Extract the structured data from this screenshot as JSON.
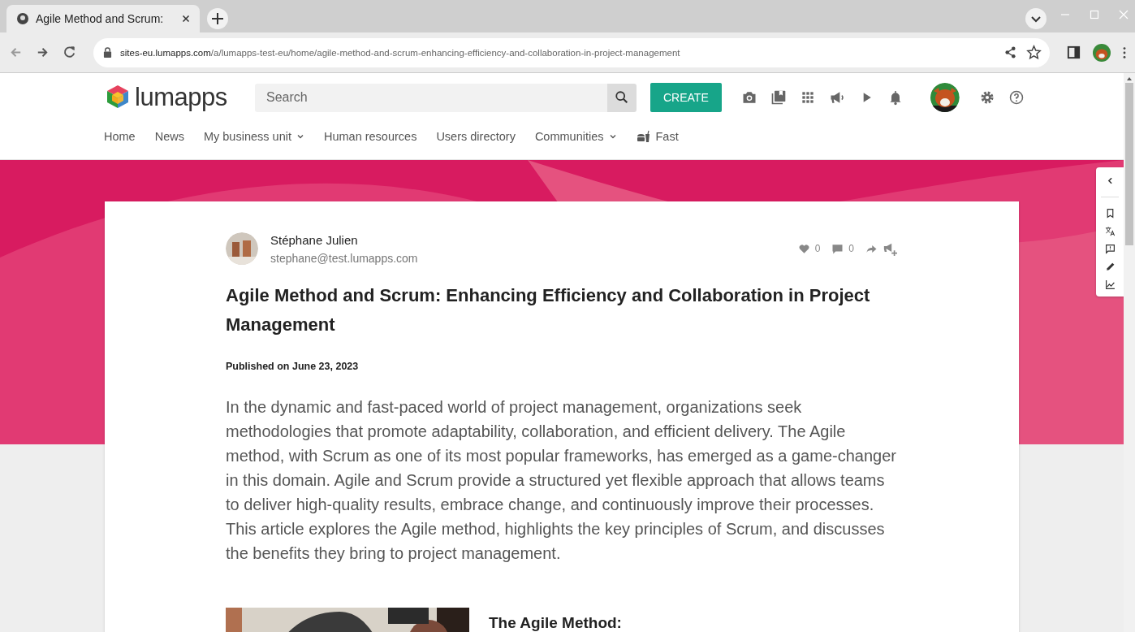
{
  "browser": {
    "tab_title": "Agile Method and Scrum:",
    "url_host": "sites-eu.lumapps.com",
    "url_path": "/a/lumapps-test-eu/home/agile-method-and-scrum-enhancing-efficiency-and-collaboration-in-project-management"
  },
  "header": {
    "logo": "lumapps",
    "search": {
      "placeholder": "Search"
    },
    "create_button": "CREATE"
  },
  "nav": [
    {
      "label": "Home",
      "kind": "plain"
    },
    {
      "label": "News",
      "kind": "plain"
    },
    {
      "label": "My business unit",
      "kind": "menu"
    },
    {
      "label": "Human resources",
      "kind": "plain"
    },
    {
      "label": "Users directory",
      "kind": "plain"
    },
    {
      "label": "Communities",
      "kind": "menu"
    },
    {
      "label": "Fast",
      "kind": "featured"
    }
  ],
  "article": {
    "author": "Stéphane Julien",
    "email": "stephane@test.lumapps.com",
    "likes": "0",
    "comments": "0",
    "title": "Agile Method and Scrum: Enhancing Efficiency and Collaboration in Project Management",
    "published": "Published on June 23, 2023",
    "intro": "In the dynamic and fast-paced world of project management, organizations seek methodologies that promote adaptability, collaboration, and efficient delivery. The Agile method, with Scrum as one of its most popular frameworks, has emerged as a game-changer in this domain. Agile and Scrum provide a structured yet flexible approach that allows teams to deliver high-quality results, embrace change, and continuously improve their processes. This article explores the Agile method, highlights the key principles of Scrum, and discusses the benefits they bring to project management.",
    "section_heading": "The Agile Method:"
  }
}
